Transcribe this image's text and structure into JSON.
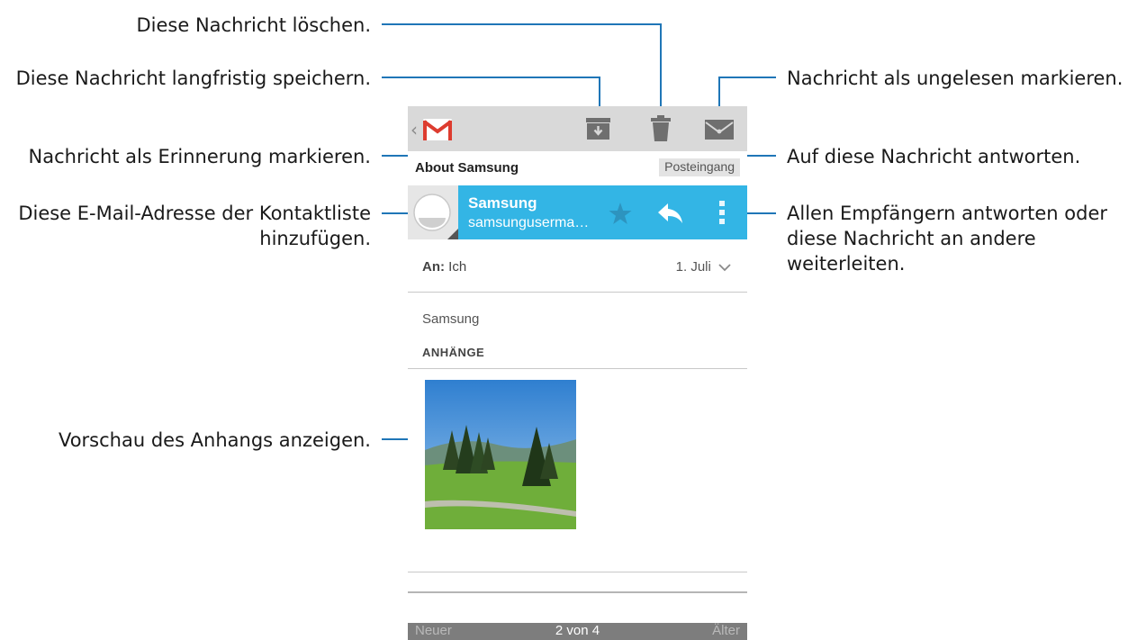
{
  "callouts": {
    "delete": "Diese Nachricht löschen.",
    "archive": "Diese Nachricht langfristig speichern.",
    "unread": "Nachricht als ungelesen markieren.",
    "star": "Nachricht als Erinnerung markieren.",
    "reply": "Auf diese Nachricht antworten.",
    "add_contact_line1": "Diese E-Mail-Adresse der Kontaktliste",
    "add_contact_line2": "hinzufügen.",
    "more_line1": "Allen Empfängern antworten oder",
    "more_line2": "diese Nachricht an andere",
    "more_line3": "weiterleiten.",
    "preview": "Vorschau des Anhangs anzeigen."
  },
  "email": {
    "subject": "About Samsung",
    "label": "Posteingang",
    "sender_name": "Samsung",
    "sender_address": "samsunguserma…",
    "to_label": "An:",
    "to_value": "Ich",
    "date": "1. Juli",
    "body": "Samsung",
    "attachments_title": "ANHÄNGE"
  },
  "bottom_bar": {
    "newer": "Neuer",
    "count": "2 von 4",
    "older": "Älter"
  },
  "icons": {
    "back": "back-chevron-icon",
    "app": "gmail-icon",
    "archive": "archive-icon",
    "delete": "trash-icon",
    "unread": "envelope-icon",
    "star": "star-icon",
    "reply": "reply-icon",
    "more": "overflow-menu-icon",
    "avatar": "contact-avatar-icon",
    "chevron": "chevron-down-icon"
  },
  "colors": {
    "accent": "#33b5e5",
    "callout_line": "#1f76b7",
    "actionbar": "#d9d9d9"
  }
}
